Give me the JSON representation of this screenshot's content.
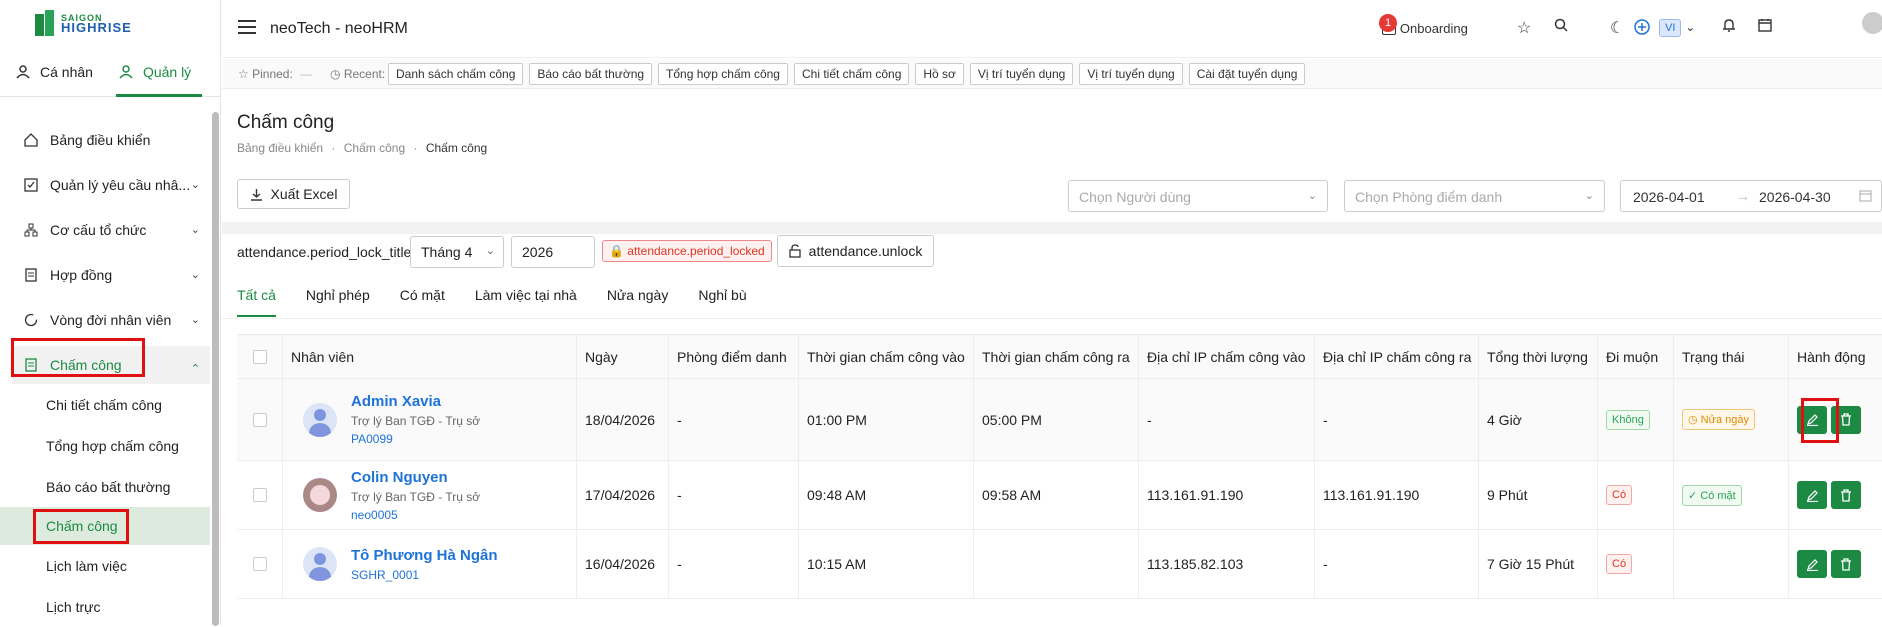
{
  "brand": {
    "line1": "SAIGON",
    "line2": "HIGHRISE"
  },
  "app_title": "neoTech - neoHRM",
  "topbar": {
    "onboarding": "Onboarding",
    "badge": "1",
    "lang": "VI"
  },
  "segments": {
    "personal": "Cá nhân",
    "manage": "Quản lý"
  },
  "nav": {
    "items": [
      {
        "label": "Bảng điều khiển"
      },
      {
        "label": "Quản lý yêu cầu nhâ..."
      },
      {
        "label": "Cơ cấu tổ chức"
      },
      {
        "label": "Hợp đồng"
      },
      {
        "label": "Vòng đời nhân viên"
      }
    ],
    "parent": "Chấm công",
    "subs": [
      "Chi tiết chấm công",
      "Tổng hợp chấm công",
      "Báo cáo bất thường",
      "Chấm công",
      "Lịch làm việc",
      "Lịch trực"
    ]
  },
  "pinbar": {
    "pinned": "Pinned:",
    "pinned_value": "—",
    "recent": "Recent:",
    "chips": [
      "Danh sách chấm công",
      "Báo cáo bất thường",
      "Tổng hợp chấm công",
      "Chi tiết chấm công",
      "Hồ sơ",
      "Vị trí tuyển dụng",
      "Vị trí tuyển dụng",
      "Cài đặt tuyển dụng"
    ]
  },
  "page": {
    "title": "Chấm công",
    "breadcrumb": [
      "Bảng điều khiển",
      "Chấm công",
      "Chấm công"
    ],
    "export": "Xuất Excel",
    "user_placeholder": "Chọn Người dùng",
    "room_placeholder": "Chọn Phòng điểm danh",
    "date_from": "2026-04-01",
    "date_to": "2026-04-30",
    "lock_title": "attendance.period_lock_title",
    "month": "Tháng 4",
    "year": "2026",
    "locked": "attendance.period_locked",
    "unlock": "attendance.unlock"
  },
  "tabs": [
    "Tất cả",
    "Nghỉ phép",
    "Có mặt",
    "Làm việc tại nhà",
    "Nửa ngày",
    "Nghỉ bù"
  ],
  "table": {
    "headers": [
      "Nhân viên",
      "Ngày",
      "Phòng điểm danh",
      "Thời gian chấm công vào",
      "Thời gian chấm công ra",
      "Địa chỉ IP chấm công vào",
      "Địa chỉ IP chấm công ra",
      "Tổng thời lượng",
      "Đi muộn",
      "Trạng thái",
      "Hành động"
    ],
    "rows": [
      {
        "name": "Admin Xavia",
        "role": "Trợ lý Ban TGĐ - Trụ sở",
        "code": "PA0099",
        "date": "18/04/2026",
        "room": "-",
        "in": "01:00 PM",
        "out": "05:00 PM",
        "ip_in": "-",
        "ip_out": "-",
        "total": "4 Giờ",
        "late": "Không",
        "status": "Nửa ngày"
      },
      {
        "name": "Colin Nguyen",
        "role": "Trợ lý Ban TGĐ - Trụ sở",
        "code": "neo0005",
        "date": "17/04/2026",
        "room": "-",
        "in": "09:48 AM",
        "out": "09:58 AM",
        "ip_in": "113.161.91.190",
        "ip_out": "113.161.91.190",
        "total": "9 Phút",
        "late": "Có",
        "status": "Có mặt"
      },
      {
        "name": "Tô Phương Hà Ngân",
        "role": "",
        "code": "SGHR_0001",
        "date": "16/04/2026",
        "room": "-",
        "in": "10:15 AM",
        "out": "",
        "ip_in": "113.185.82.103",
        "ip_out": "-",
        "total": "7 Giờ 15 Phút",
        "late": "Có",
        "status": ""
      }
    ]
  }
}
